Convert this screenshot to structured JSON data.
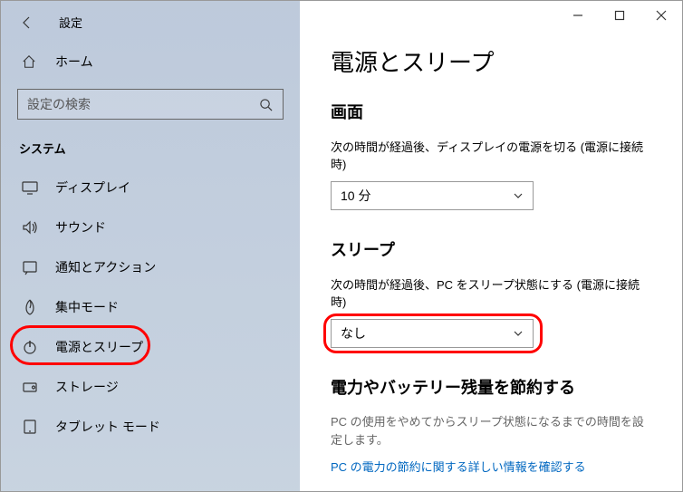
{
  "window": {
    "title": "設定"
  },
  "sidebar": {
    "home": "ホーム",
    "search_placeholder": "設定の検索",
    "category": "システム",
    "items": [
      {
        "label": "ディスプレイ"
      },
      {
        "label": "サウンド"
      },
      {
        "label": "通知とアクション"
      },
      {
        "label": "集中モード"
      },
      {
        "label": "電源とスリープ"
      },
      {
        "label": "ストレージ"
      },
      {
        "label": "タブレット モード"
      }
    ]
  },
  "main": {
    "page_title": "電源とスリープ",
    "screen": {
      "heading": "画面",
      "label": "次の時間が経過後、ディスプレイの電源を切る (電源に接続時)",
      "value": "10 分"
    },
    "sleep": {
      "heading": "スリープ",
      "label": "次の時間が経過後、PC をスリープ状態にする (電源に接続時)",
      "value": "なし"
    },
    "battery": {
      "heading": "電力やバッテリー残量を節約する",
      "description": "PC の使用をやめてからスリープ状態になるまでの時間を設定します。",
      "link": "PC の電力の節約に関する詳しい情報を確認する"
    }
  }
}
